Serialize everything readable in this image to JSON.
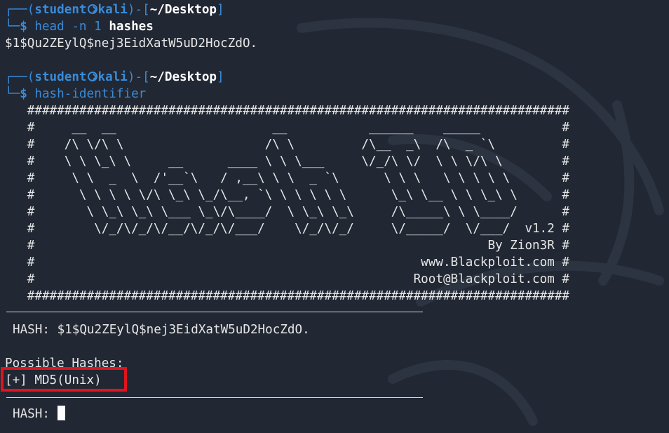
{
  "prompt": {
    "frame_left": "┌──(",
    "user": "student",
    "host": "kali",
    "frame_mid": ")-[",
    "path": "~/Desktop",
    "frame_right": "]",
    "frame_bottom": "└─",
    "dollar": "$"
  },
  "commands": [
    {
      "cmd": "head",
      "args_plain": " -n 1 ",
      "args_bold": "hashes"
    },
    {
      "cmd": "hash-identifier",
      "args_plain": "",
      "args_bold": ""
    }
  ],
  "head_output": "$1$Qu2ZEylQ$nej3EidXatW5uD2HocZdO.",
  "banner_lines": [
    "   #########################################################################",
    "   #     __  __                     __           ______    _____           #",
    "   #    /\\ \\/\\ \\                   /\\ \\         /\\__  _\\  /\\  _ `\\         #",
    "   #    \\ \\ \\_\\ \\     __      ____ \\ \\ \\___     \\/_/\\ \\/  \\ \\ \\/\\ \\        #",
    "   #     \\ \\  _  \\  /'__`\\   / ,__\\ \\ \\  _ `\\      \\ \\ \\   \\ \\ \\ \\ \\       #",
    "   #      \\ \\ \\ \\ \\/\\ \\_\\ \\_/\\__, `\\ \\ \\ \\ \\ \\      \\_\\ \\__ \\ \\ \\_\\ \\      #",
    "   #       \\ \\_\\ \\_\\ \\___ \\_\\/\\____/  \\ \\_\\ \\_\\     /\\_____\\ \\ \\____/      #",
    "   #        \\/_/\\/_/\\/__/\\/_/\\/___/    \\/_/\\/_/     \\/_____/  \\/___/  v1.2 #",
    "   #                                                             By Zion3R #",
    "   #                                                    www.Blackploit.com #",
    "   #                                                   Root@Blackploit.com #",
    "   #########################################################################"
  ],
  "hash_label": "HASH: ",
  "hash_value": "$1$Qu2ZEylQ$nej3EidXatW5uD2HocZdO.",
  "possible_hashes_label": "Possible Hashes:",
  "result": "[+] MD5(Unix)",
  "prompt2_label": "HASH: "
}
